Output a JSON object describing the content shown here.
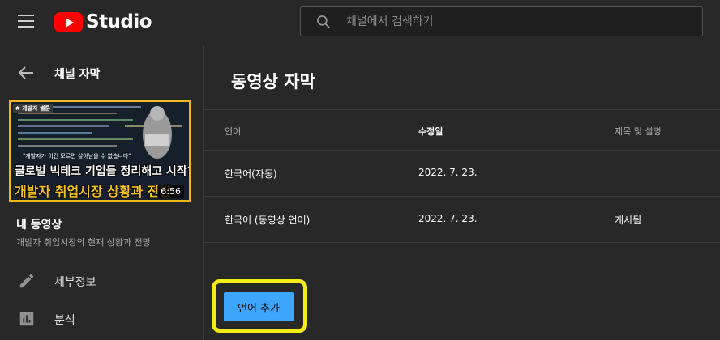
{
  "header": {
    "app_name": "Studio",
    "search": {
      "placeholder": "채널에서 검색하기"
    }
  },
  "sidebar": {
    "back_label": "채널 자막",
    "video": {
      "thumbnail": {
        "tag": "# 개발자 썰툰",
        "quote": "\"개발자가 이건 모르면 살아남을 수 없습니다\"",
        "headline": "글로벌 빅테크 기업들 정리해고 시작?",
        "subheadline": "개발자 취업시장 상황과 전망",
        "duration": "6:56"
      },
      "title": "내 동영상",
      "subtitle": "개발자 취업시장의 현재 상황과 전망"
    },
    "nav": [
      {
        "label": "세부정보",
        "icon": "pencil-icon"
      },
      {
        "label": "분석",
        "icon": "analytics-icon"
      }
    ]
  },
  "main": {
    "title": "동영상 자막",
    "table": {
      "columns": [
        "언어",
        "수정일",
        "제목 및 설명"
      ],
      "rows": [
        {
          "language": "한국어(자동)",
          "modified": "2022. 7. 23.",
          "title_desc": ""
        },
        {
          "language": "한국어 (동영상 언어)",
          "modified": "2022. 7. 23.",
          "title_desc": "게시됨"
        }
      ]
    },
    "add_language_label": "언어 추가"
  },
  "colors": {
    "background": "#282828",
    "accent": "#3ea6ff",
    "brand": "#ff0000",
    "highlight": "#f4ec14"
  }
}
